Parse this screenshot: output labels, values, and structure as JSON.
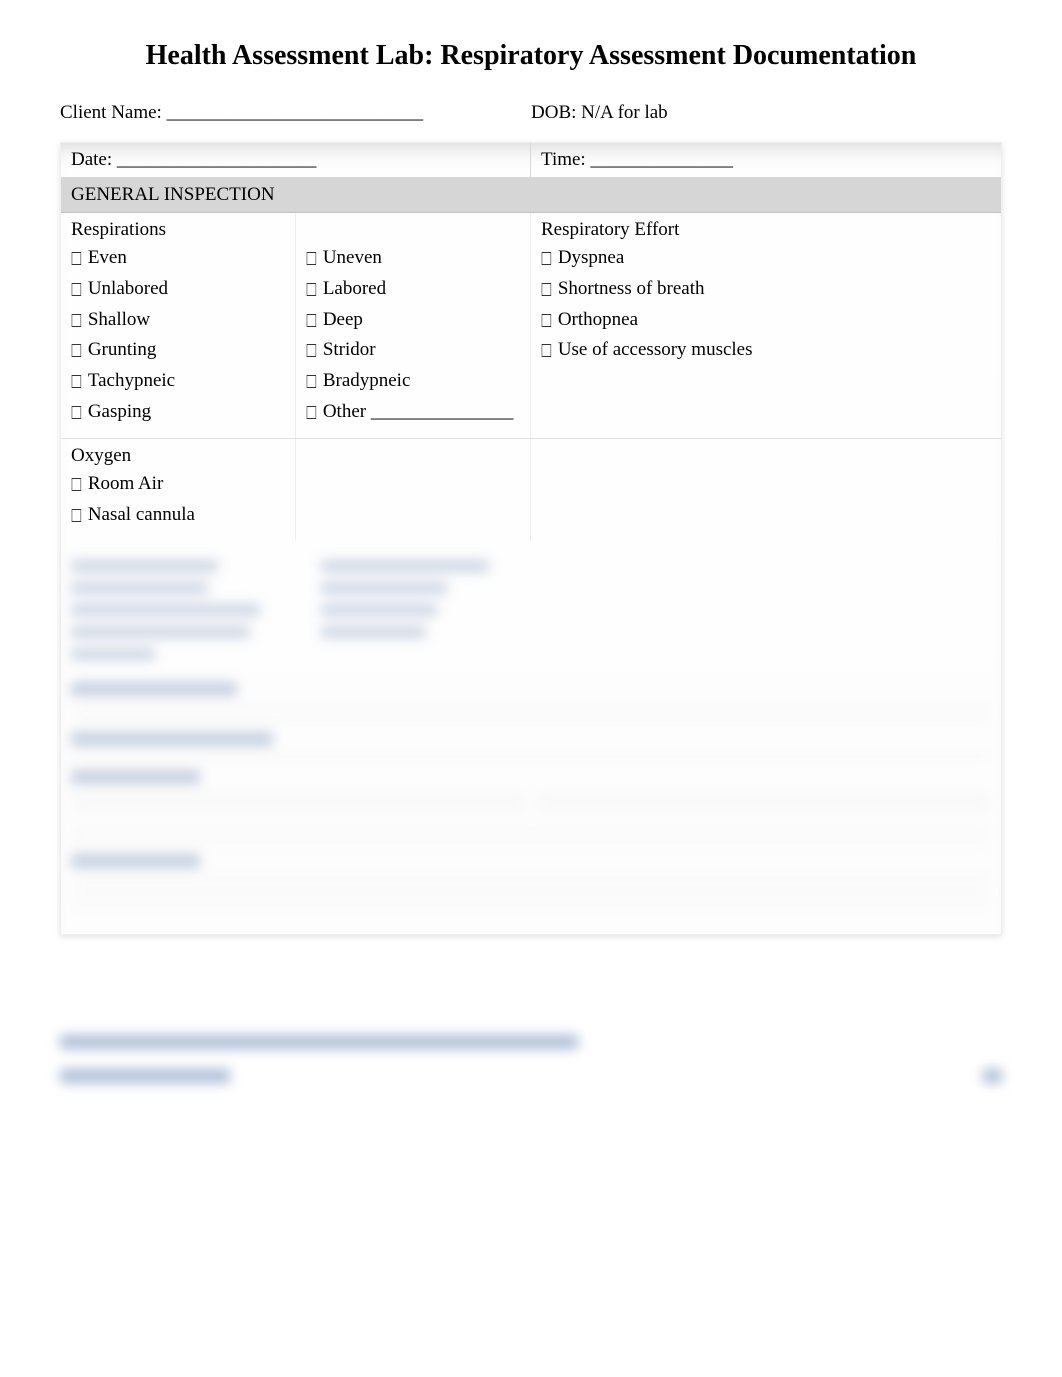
{
  "title": "Health Assessment Lab: Respiratory Assessment Documentation",
  "clientName": "Client Name: ___________________________",
  "dob": "DOB: N/A for lab",
  "date": "Date: _____________________",
  "time": "Time: _______________",
  "sections": {
    "generalInspection": "GENERAL INSPECTION",
    "respirations": {
      "heading": "Respirations",
      "colA": [
        "Even",
        "Unlabored",
        "Shallow",
        "Grunting",
        "Tachypneic",
        "Gasping"
      ],
      "colB": [
        "Uneven",
        "Labored",
        "Deep",
        "Stridor",
        "Bradypneic",
        "Other _______________"
      ]
    },
    "respiratoryEffort": {
      "heading": "Respiratory Effort",
      "items": [
        "Dyspnea",
        "Shortness of breath",
        "Orthopnea",
        "Use of accessory muscles"
      ]
    },
    "oxygen": {
      "heading": "Oxygen",
      "items": [
        "Room Air",
        "Nasal cannula"
      ]
    }
  },
  "checkbox": "⎕"
}
